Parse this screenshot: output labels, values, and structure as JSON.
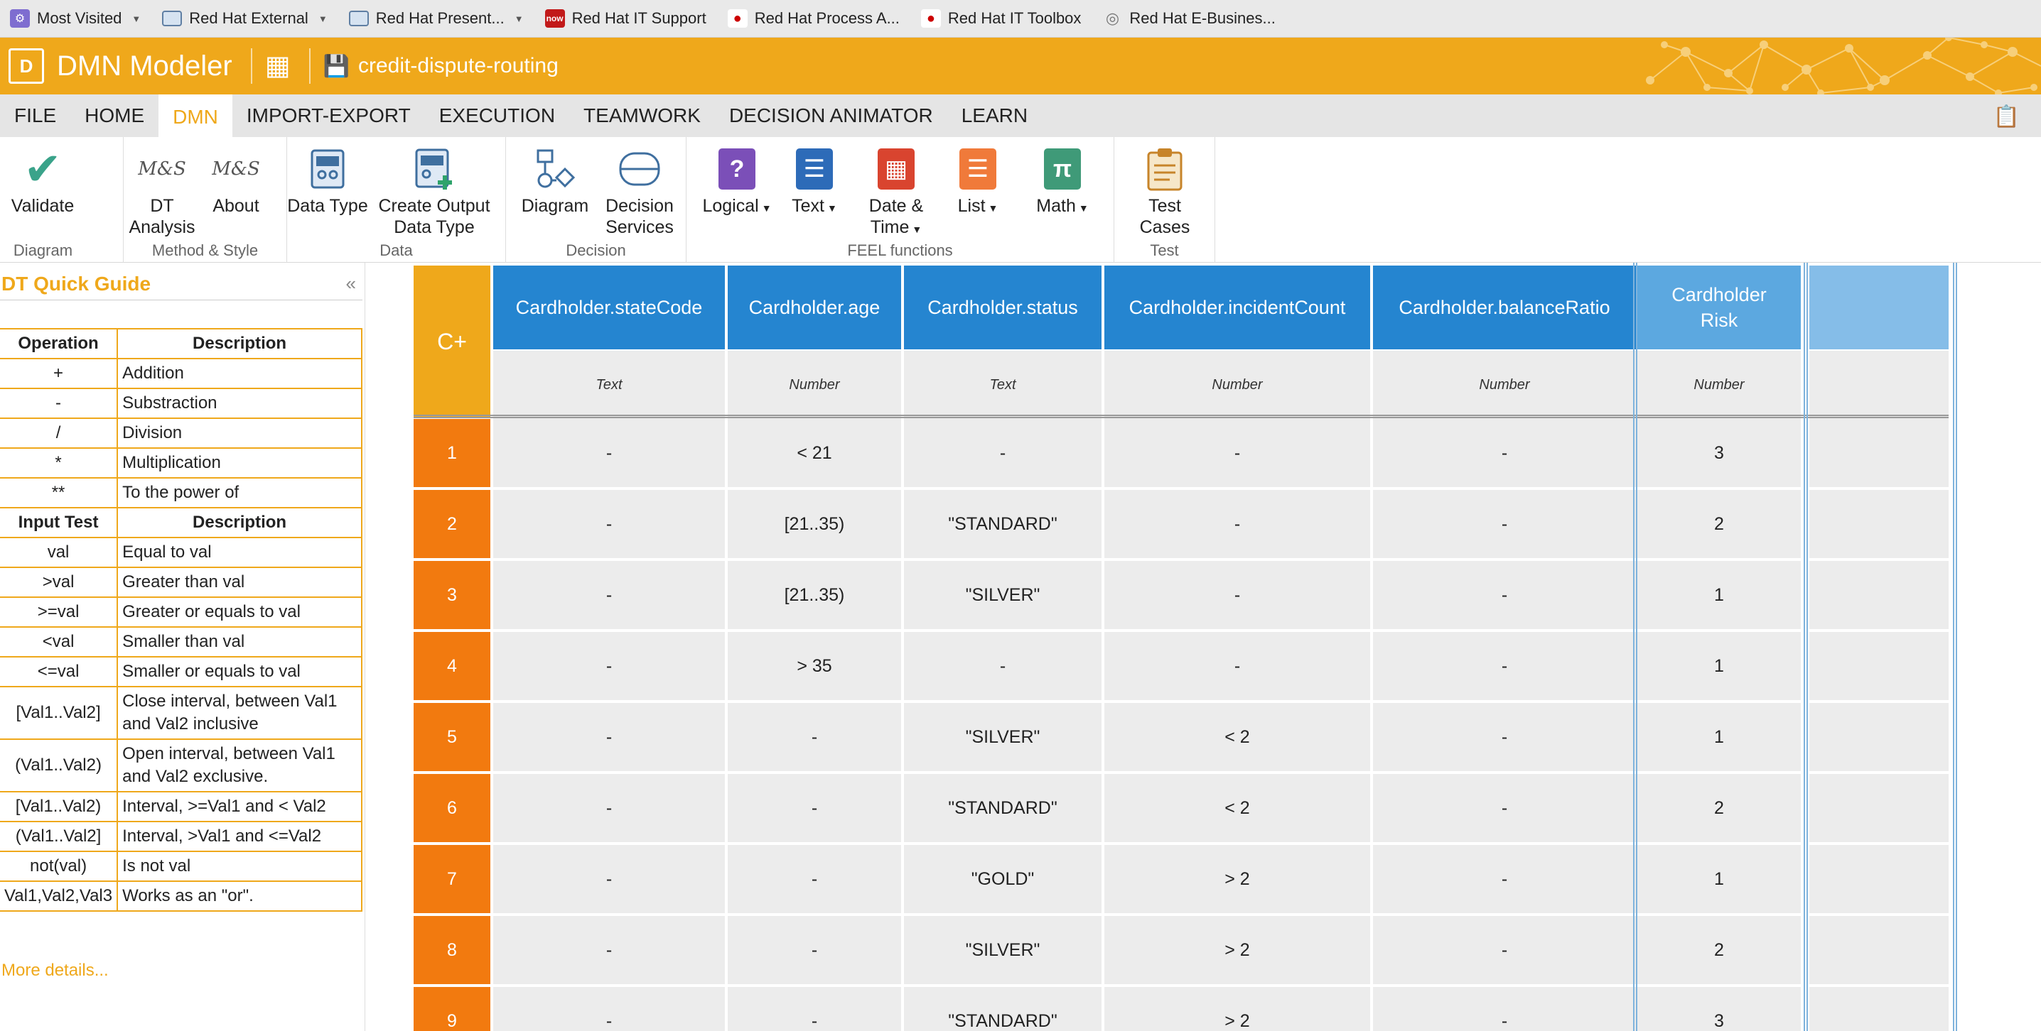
{
  "bookmarks": [
    {
      "label": "Most Visited",
      "icon": "gear-icon",
      "dropdown": true
    },
    {
      "label": "Red Hat External",
      "icon": "folder-icon",
      "dropdown": true
    },
    {
      "label": "Red Hat Present...",
      "icon": "folder-icon",
      "dropdown": true
    },
    {
      "label": "Red Hat IT Support",
      "icon": "now-icon",
      "dropdown": false
    },
    {
      "label": "Red Hat Process A...",
      "icon": "redhat-icon",
      "dropdown": false
    },
    {
      "label": "Red Hat IT Toolbox",
      "icon": "redhat-icon",
      "dropdown": false
    },
    {
      "label": "Red Hat E-Busines...",
      "icon": "globe-icon",
      "dropdown": false
    }
  ],
  "app": {
    "logo_text": "D",
    "title": "DMN Modeler",
    "document_name": "credit-dispute-routing",
    "brand_color": "#efa81b"
  },
  "menu": {
    "tabs": [
      "FILE",
      "HOME",
      "DMN",
      "IMPORT-EXPORT",
      "EXECUTION",
      "TEAMWORK",
      "DECISION ANIMATOR",
      "LEARN"
    ],
    "active": "DMN"
  },
  "ribbon": {
    "groups": {
      "diagram": "Diagram",
      "method_style": "Method & Style",
      "data": "Data",
      "decision": "Decision",
      "feel": "FEEL functions",
      "test": "Test"
    },
    "buttons": {
      "validate": "Validate",
      "dt_analysis_1": "DT",
      "dt_analysis_2": "Analysis",
      "about": "About",
      "data_type": "Data Type",
      "create_output_1": "Create Output",
      "create_output_2": "Data Type",
      "diagram": "Diagram",
      "decision_services_1": "Decision",
      "decision_services_2": "Services",
      "logical": "Logical",
      "text": "Text",
      "date_time_1": "Date &",
      "date_time_2": "Time",
      "list": "List",
      "math": "Math",
      "test_cases_1": "Test",
      "test_cases_2": "Cases"
    },
    "ms_logo": "M&S",
    "math_glyph": "π",
    "logical_glyph": "?"
  },
  "quick_guide": {
    "title": "DT Quick Guide",
    "collapse_glyph": "«",
    "op_header": [
      "Operation",
      "Description"
    ],
    "operations": [
      [
        "+",
        "Addition"
      ],
      [
        "-",
        "Substraction"
      ],
      [
        "/",
        "Division"
      ],
      [
        "*",
        "Multiplication"
      ],
      [
        "**",
        "To the power of"
      ]
    ],
    "test_header": [
      "Input Test",
      "Description"
    ],
    "tests": [
      [
        "val",
        "Equal to val"
      ],
      [
        ">val",
        "Greater than val"
      ],
      [
        ">=val",
        "Greater or equals to val"
      ],
      [
        "<val",
        "Smaller than val"
      ],
      [
        "<=val",
        "Smaller or equals to val"
      ],
      [
        "[Val1..Val2]",
        "Close interval, between Val1 and Val2 inclusive"
      ],
      [
        "(Val1..Val2)",
        "Open interval, between Val1 and Val2 exclusive."
      ],
      [
        "[Val1..Val2)",
        "Interval, >=Val1 and < Val2"
      ],
      [
        "(Val1..Val2]",
        "Interval, >Val1 and <=Val2"
      ],
      [
        "not(val)",
        "Is not val"
      ],
      [
        "Val1,Val2,Val3",
        "Works as an \"or\"."
      ]
    ],
    "more_link": "More details..."
  },
  "decision_table": {
    "hit_policy": "C+",
    "inputs": [
      {
        "name": "Cardholder.stateCode",
        "type": "Text"
      },
      {
        "name": "Cardholder.age",
        "type": "Number"
      },
      {
        "name": "Cardholder.status",
        "type": "Text"
      },
      {
        "name": "Cardholder.incidentCount",
        "type": "Number"
      },
      {
        "name": "Cardholder.balanceRatio",
        "type": "Number"
      }
    ],
    "output": {
      "name": "Cardholder Risk",
      "type": "Number"
    },
    "rules": [
      [
        "1",
        "-",
        "< 21",
        "-",
        "-",
        "-",
        "3"
      ],
      [
        "2",
        "-",
        "[21..35)",
        "\"STANDARD\"",
        "-",
        "-",
        "2"
      ],
      [
        "3",
        "-",
        "[21..35)",
        "\"SILVER\"",
        "-",
        "-",
        "1"
      ],
      [
        "4",
        "-",
        "> 35",
        "-",
        "-",
        "-",
        "1"
      ],
      [
        "5",
        "-",
        "-",
        "\"SILVER\"",
        "< 2",
        "-",
        "1"
      ],
      [
        "6",
        "-",
        "-",
        "\"STANDARD\"",
        "< 2",
        "-",
        "2"
      ],
      [
        "7",
        "-",
        "-",
        "\"GOLD\"",
        "> 2",
        "-",
        "1"
      ],
      [
        "8",
        "-",
        "-",
        "\"SILVER\"",
        "> 2",
        "-",
        "2"
      ],
      [
        "9",
        "-",
        "-",
        "\"STANDARD\"",
        "> 2",
        "-",
        "3"
      ]
    ]
  }
}
